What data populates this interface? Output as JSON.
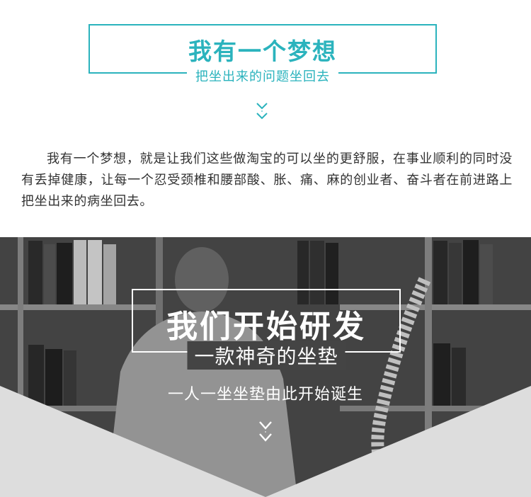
{
  "header": {
    "title": "我有一个梦想",
    "subtitle": "把坐出来的问题坐回去"
  },
  "intro": {
    "text": "我有一个梦想，就是让我们这些做淘宝的可以坐的更舒服，在事业顺利的同时没有丢掉健康，让每一个忍受颈椎和腰部酸、胀、痛、麻的创业者、奋斗者在前进路上把坐出来的病坐回去。"
  },
  "banner": {
    "title": "我们开始研发",
    "subtitle": "一款神奇的坐垫",
    "caption": "一人一坐坐垫由此开始诞生"
  },
  "colors": {
    "accent": "#2bb3bd",
    "text": "#333333",
    "photo_overlay": "#3f3f3f"
  },
  "icons": {
    "top_chevron": "double-chevron-down-icon",
    "banner_chevron": "double-chevron-down-icon"
  }
}
